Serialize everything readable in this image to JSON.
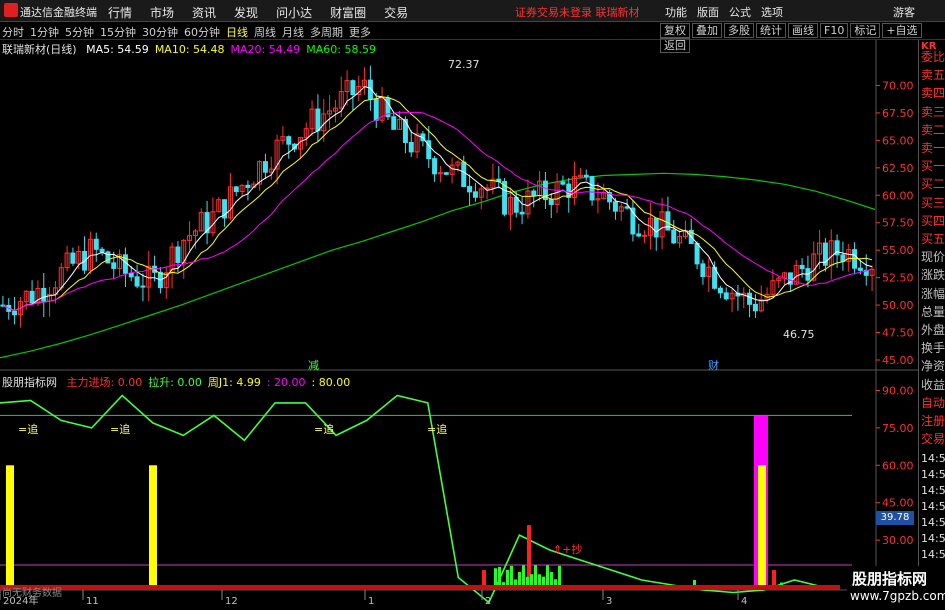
{
  "topbar": {
    "app_name": "通达信金融终端",
    "menus": [
      "行情",
      "市场",
      "资讯",
      "发现",
      "问小达",
      "财富圈",
      "交易"
    ],
    "banner": "证券交易未登录  联瑞新材",
    "right_menus": [
      "功能",
      "版面",
      "公式",
      "选项"
    ],
    "guest": "游客"
  },
  "periods": {
    "items": [
      "分时",
      "1分钟",
      "5分钟",
      "15分钟",
      "30分钟",
      "60分钟",
      "日线",
      "周线",
      "月线",
      "多周期",
      "更多"
    ],
    "active": "日线",
    "tools": [
      "复权",
      "叠加",
      "多股",
      "统计",
      "画线",
      "F10",
      "标记",
      "+自选",
      "返回"
    ]
  },
  "main_chart": {
    "stock_title": "联瑞新材(日线)",
    "ma": [
      {
        "label": "MA5: 54.59",
        "color": "#ffffff"
      },
      {
        "label": "MA10: 54.48",
        "color": "#ffff00"
      },
      {
        "label": "MA20: 54.49",
        "color": "#ff00ff"
      },
      {
        "label": "MA60: 58.59",
        "color": "#00ff00"
      }
    ],
    "high_label": "72.37",
    "low_label": "46.75",
    "markers": [
      "减",
      "财"
    ],
    "price_ticks": [
      "70.00",
      "67.50",
      "65.00",
      "62.50",
      "60.00",
      "57.50",
      "55.00",
      "52.50",
      "50.00",
      "47.50",
      "45.00"
    ]
  },
  "indicator": {
    "name": "股朋指标网",
    "values": [
      {
        "label": "主力进场: 0.00",
        "color": "#ff3030"
      },
      {
        "label": "拉升: 0.00",
        "color": "#40ff40"
      },
      {
        "label": "周J1: 4.99",
        "color": "#ffff00"
      },
      {
        "label": ": 20.00",
        "color": "#ff00ff"
      },
      {
        "label": ": 80.00",
        "color": "#ffff00"
      }
    ],
    "zhui": "=追",
    "chao": "⇑+抄",
    "ticks": [
      "90.00",
      "75.00",
      "60.00",
      "45.00",
      "39.78",
      "30.00",
      "15.00"
    ],
    "bottom_label": "尚无财务数据"
  },
  "time_axis": [
    "2024年",
    "11",
    "12",
    "1",
    "2",
    "3",
    "4"
  ],
  "right_panel": {
    "header": "KR",
    "items": [
      "委比",
      "卖五",
      "卖四",
      "卖三",
      "卖二",
      "卖一",
      "买一",
      "买二",
      "买三",
      "买四",
      "买五",
      "现价",
      "涨跌",
      "涨幅",
      "总量",
      "外盘",
      "换手",
      "净资",
      "收益",
      "自动",
      "注册",
      "交易"
    ],
    "times": [
      "14:55",
      "14:55",
      "14:55",
      "14:55",
      "14:55",
      "14:55",
      "14:56",
      "14:56",
      "14:56",
      "14:56"
    ]
  },
  "watermark": {
    "title": "股朋指标网",
    "url": "www.7gpzb.com"
  },
  "chart_data": {
    "type": "candlestick",
    "price_range": [
      45.0,
      72.5
    ],
    "indicator_range": [
      10,
      95
    ],
    "ma60": [
      45.2,
      45.8,
      46.5,
      47.3,
      48.2,
      49.1,
      50.0,
      51.0,
      52.0,
      53.0,
      54.0,
      55.0,
      55.8,
      56.7,
      57.6,
      58.6,
      59.4,
      60.3,
      61.0,
      61.5,
      61.8,
      61.9,
      62.0,
      61.9,
      61.7,
      61.4,
      61.0,
      60.4,
      59.6,
      58.7
    ],
    "jline": [
      85,
      86,
      78,
      75,
      88,
      77,
      72,
      80,
      70,
      85,
      85,
      72,
      78,
      88,
      85,
      15,
      5,
      32,
      26,
      22,
      18,
      14,
      12,
      10,
      9,
      10,
      14,
      11
    ]
  }
}
